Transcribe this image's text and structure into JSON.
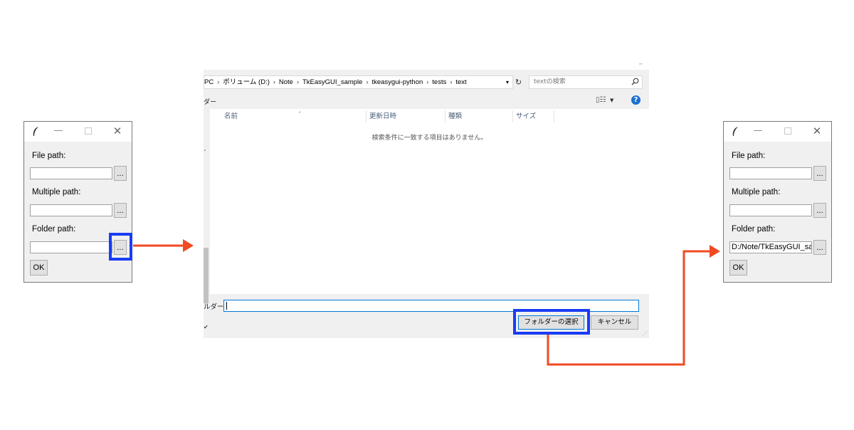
{
  "left_window": {
    "labels": {
      "file": "File path:",
      "multiple": "Multiple path:",
      "folder": "Folder path:"
    },
    "values": {
      "file": "",
      "multiple": "",
      "folder": ""
    },
    "browse_label": "...",
    "ok_label": "OK",
    "controls": {
      "minimize": "—",
      "close": "✕"
    }
  },
  "dialog": {
    "corner_mark": "ʻʻ",
    "breadcrumbs": [
      "PC",
      "ボリューム (D:)",
      "Note",
      "TkEasyGUI_sample",
      "tkeasygui-python",
      "tests",
      "text"
    ],
    "breadcrumb_separator": "›",
    "search_placeholder": "textの検索",
    "toolbar_label": "ダー",
    "columns": [
      "名前",
      "更新日時",
      "種類",
      "サイズ"
    ],
    "empty_message": "検索条件に一致する項目はありません。",
    "folder_label": "ルダー:",
    "folder_value": "",
    "select_button": "フォルダーの選択",
    "cancel_button": "キャンセル"
  },
  "right_window": {
    "labels": {
      "file": "File path:",
      "multiple": "Multiple path:",
      "folder": "Folder path:"
    },
    "values": {
      "file": "",
      "multiple": "",
      "folder": "D:/Note/TkEasyGUI_sar"
    },
    "browse_label": "...",
    "ok_label": "OK",
    "controls": {
      "minimize": "—",
      "close": "✕"
    }
  },
  "colors": {
    "highlight": "#1a3cf5",
    "arrow": "#f04a23",
    "help": "#1c6fd1"
  }
}
